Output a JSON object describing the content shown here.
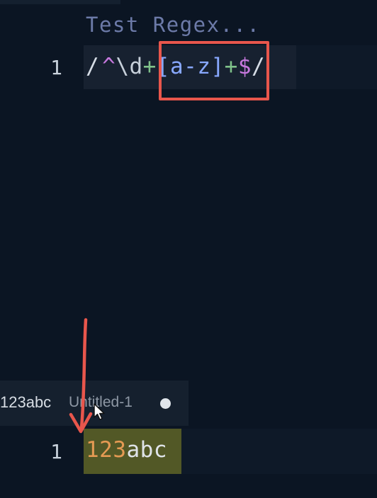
{
  "regex_editor": {
    "placeholder": "Test Regex...",
    "line_number": "1",
    "tokens": {
      "open_slash": "/",
      "anchor_start": "^",
      "digit_class": "\\d",
      "plus_1": "+",
      "char_set": "[a-z]",
      "plus_2": "+",
      "anchor_end": "$",
      "close_slash": "/"
    }
  },
  "test_editor": {
    "tab": {
      "title": "123abc",
      "subtitle": "Untitled-1"
    },
    "line_number": "1",
    "text_digits": "123",
    "text_letters": "abc"
  },
  "colors": {
    "background": "#0b1523",
    "annotation": "#e8564c",
    "match_highlight": "#525826"
  },
  "icons": [
    "cursor-pointer-icon",
    "unsaved-dot-icon",
    "annotation-arrow"
  ]
}
